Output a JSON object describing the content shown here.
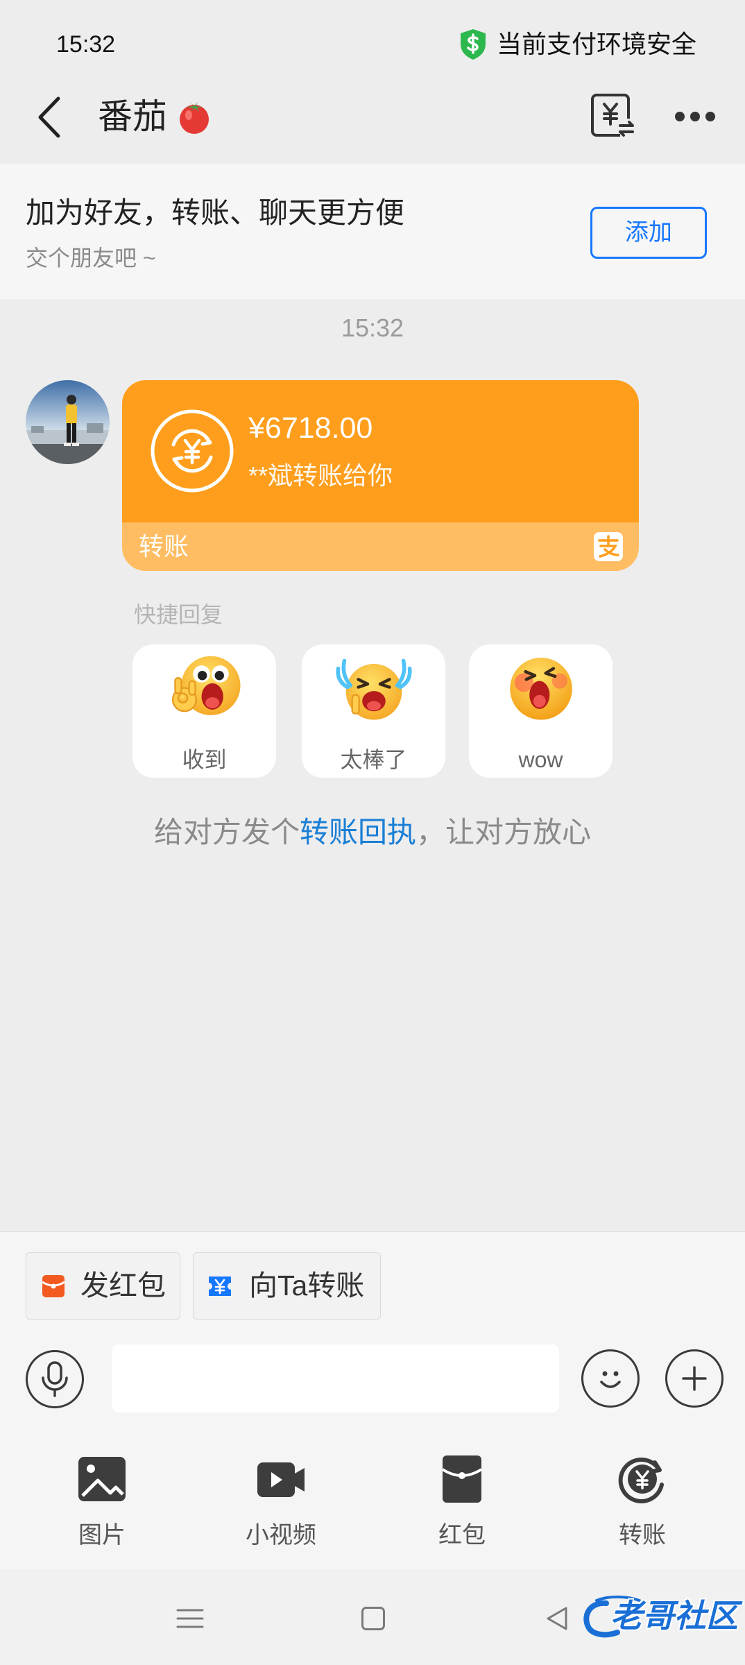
{
  "status_bar": {
    "time": "15:32",
    "security_text": "当前支付环境安全",
    "security_icon": "shield-dollar-icon"
  },
  "header": {
    "title": "番茄",
    "title_icon": "tomato-icon",
    "back_icon": "back-arrow-icon",
    "transfer_icon": "yuan-transfer-icon",
    "more_icon": "more-dots-icon"
  },
  "friend_banner": {
    "title": "加为好友，转账、聊天更方便",
    "subtitle": "交个朋友吧 ~",
    "add_label": "添加"
  },
  "chat": {
    "timestamp": "15:32",
    "transfer": {
      "amount": "¥6718.00",
      "note": "**斌转账给你",
      "footer": "转账",
      "icon": "yuan-cycle-icon",
      "brand_icon": "alipay-icon"
    }
  },
  "quick_reply": {
    "label": "快捷回复",
    "items": [
      {
        "label": "收到",
        "icon": "ok-hand-emoji"
      },
      {
        "label": "太棒了",
        "icon": "crying-laugh-emoji"
      },
      {
        "label": "wow",
        "icon": "wow-emoji"
      }
    ]
  },
  "receipt_hint": {
    "prefix": "给对方发个",
    "link": "转账回执",
    "suffix": "，让对方放心"
  },
  "chips": [
    {
      "label": "发红包",
      "icon": "red-envelope-icon"
    },
    {
      "label": "向Ta转账",
      "icon": "transfer-ticket-icon"
    }
  ],
  "input_bar": {
    "voice_icon": "microphone-icon",
    "emoji_icon": "smiley-icon",
    "plus_icon": "plus-icon",
    "value": ""
  },
  "toolbar": [
    {
      "label": "图片",
      "icon": "image-icon"
    },
    {
      "label": "小视频",
      "icon": "video-icon"
    },
    {
      "label": "红包",
      "icon": "red-envelope-icon"
    },
    {
      "label": "转账",
      "icon": "transfer-icon"
    }
  ],
  "nav_bar": {
    "icons": [
      "menu-icon",
      "home-square-icon",
      "back-triangle-icon"
    ]
  },
  "watermark": {
    "text": "老哥社区"
  },
  "colors": {
    "background": "#ededed",
    "transfer_orange": "#fe9e1c",
    "transfer_orange_light": "#ffbd63",
    "link_blue": "#1a7fd6",
    "button_blue": "#1677ff",
    "security_green": "#2db84d",
    "red_envelope": "#f25a22"
  }
}
